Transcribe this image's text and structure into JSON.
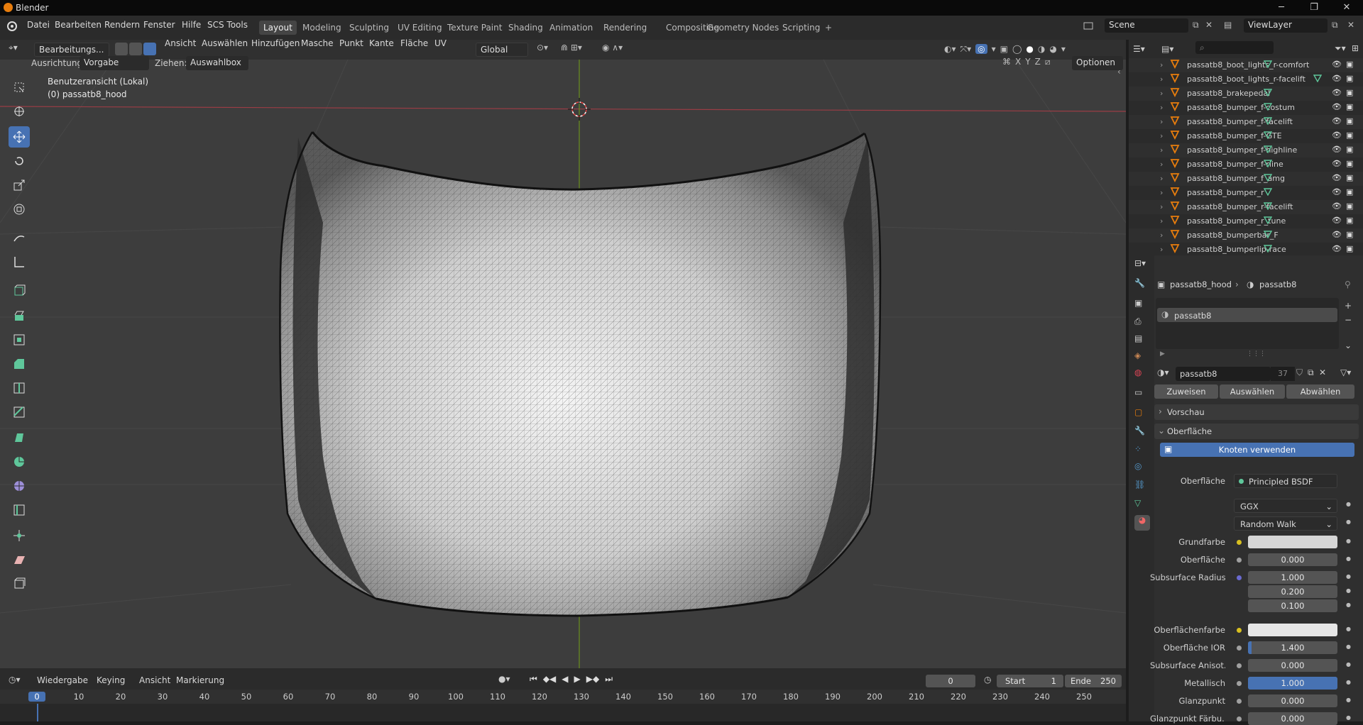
{
  "title": "Blender",
  "menus": [
    "Datei",
    "Bearbeiten",
    "Rendern",
    "Fenster",
    "Hilfe",
    "SCS Tools"
  ],
  "workspaces": [
    "Layout",
    "Modeling",
    "Sculpting",
    "UV Editing",
    "Texture Paint",
    "Shading",
    "Animation",
    "Rendering",
    "Compositing",
    "Geometry Nodes",
    "Scripting"
  ],
  "workspace_active": "Layout",
  "workspace_add": "+",
  "scene": "Scene",
  "view_layer": "ViewLayer",
  "header3d": {
    "mode": "Bearbeitungs...",
    "menus": [
      "Ansicht",
      "Auswählen",
      "Hinzufügen",
      "Masche",
      "Punkt",
      "Kante",
      "Fläche",
      "UV"
    ],
    "transform": "Global"
  },
  "toolbar2": {
    "orient_label": "Ausrichtung:",
    "orient_value": "Vorgabe",
    "drag_label": "Ziehen:",
    "drag_value": "Auswahlbox",
    "options": "Optionen",
    "xyz": [
      "X",
      "Y",
      "Z"
    ]
  },
  "viewport": {
    "view_name": "Benutzeransicht (Lokal)",
    "object": "(0) passatb8_hood"
  },
  "outliner": {
    "items": [
      "passatb8_boot_lights_r-comfort",
      "passatb8_boot_lights_r-facelift",
      "passatb8_brakepedal",
      "passatb8_bumper_f-costum",
      "passatb8_bumper_f-facelift",
      "passatb8_bumper_f-GTE",
      "passatb8_bumper_f-highline",
      "passatb8_bumper_f-rline",
      "passatb8_bumper_f_amg",
      "passatb8_bumper_r",
      "passatb8_bumper_r-facelift",
      "passatb8_bumper_r_tune",
      "passatb8_bumperbar_F",
      "passatb8_bumperlip-race"
    ]
  },
  "properties": {
    "breadcrumb_object": "passatb8_hood",
    "breadcrumb_material": "passatb8",
    "slot": "passatb8",
    "material_name": "passatb8",
    "users": "37",
    "assign": "Zuweisen",
    "select": "Auswählen",
    "deselect": "Abwählen",
    "preview": "Vorschau",
    "surface_panel": "Oberfläche",
    "use_nodes": "Knoten verwenden",
    "surface_label": "Oberfläche",
    "surface_value": "Principled BSDF",
    "distribution": "GGX",
    "subsurface_method": "Random Walk",
    "rows": [
      {
        "label": "Grundfarbe",
        "value": "",
        "color": "#d6d6d6",
        "dot": "#d8c020"
      },
      {
        "label": "Oberfläche",
        "value": "0.000",
        "dot": "#a0a0a0"
      },
      {
        "label": "Subsurface Radius",
        "value": "1.000",
        "dot": "#6a6ad0"
      },
      {
        "label": "",
        "value": "0.200"
      },
      {
        "label": "",
        "value": "0.100"
      },
      {
        "label": "Oberflächenfarbe",
        "value": "",
        "color": "#e6e6e6",
        "dot": "#d8c020"
      },
      {
        "label": "Oberfläche IOR",
        "value": "1.400",
        "dot": "#a0a0a0",
        "fill": 0.04
      },
      {
        "label": "Subsurface Anisot...",
        "value": "0.000",
        "dot": "#a0a0a0"
      },
      {
        "label": "Metallisch",
        "value": "1.000",
        "dot": "#a0a0a0",
        "fill": 1.0
      },
      {
        "label": "Glanzpunkt",
        "value": "0.000",
        "dot": "#a0a0a0"
      },
      {
        "label": "Glanzpunkt Färbu...",
        "value": "0.000",
        "dot": "#a0a0a0"
      }
    ]
  },
  "timeline": {
    "menus": [
      "Wiedergabe",
      "Keying",
      "Ansicht",
      "Markierung"
    ],
    "current_frame": "0",
    "start_label": "Start",
    "start": "1",
    "end_label": "Ende",
    "end": "250",
    "ticks": [
      "0",
      "10",
      "20",
      "30",
      "40",
      "50",
      "60",
      "70",
      "80",
      "90",
      "100",
      "110",
      "120",
      "130",
      "140",
      "150",
      "160",
      "170",
      "180",
      "190",
      "200",
      "210",
      "220",
      "230",
      "240",
      "250"
    ]
  },
  "colors": {
    "accent": "#4772b3",
    "object_orange": "#e87d0d",
    "mesh_green": "#5fc79b"
  }
}
